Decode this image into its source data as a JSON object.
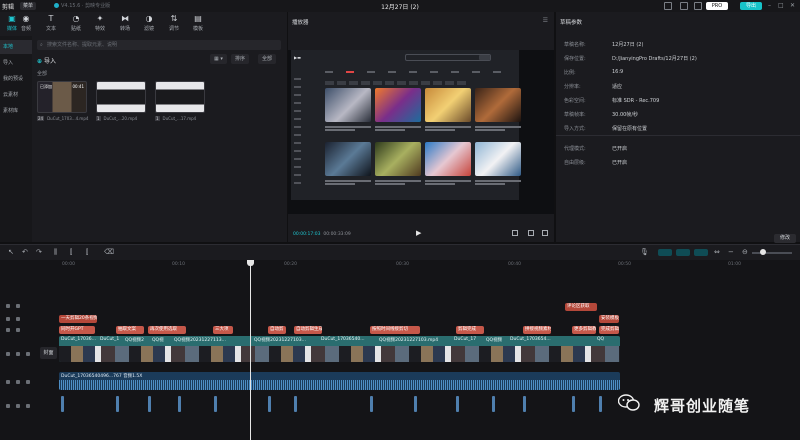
{
  "titlebar": {
    "app_name": "剪辑",
    "menu": "菜单",
    "version": "V4.15.6 · 剪映专业版",
    "doc_title": "12月27日 (2)",
    "pro_label": "PRO",
    "export_label": "导出"
  },
  "toolbar": {
    "tools": [
      {
        "label": "媒体",
        "icon": "media-icon",
        "glyph": "▣",
        "active": true
      },
      {
        "label": "音频",
        "icon": "audio-icon",
        "glyph": "◉"
      },
      {
        "label": "文本",
        "icon": "text-icon",
        "glyph": "T"
      },
      {
        "label": "贴纸",
        "icon": "sticker-icon",
        "glyph": "◔"
      },
      {
        "label": "特效",
        "icon": "effects-icon",
        "glyph": "✦"
      },
      {
        "label": "转场",
        "icon": "transition-icon",
        "glyph": "⧓"
      },
      {
        "label": "滤镜",
        "icon": "filter-icon",
        "glyph": "◑"
      },
      {
        "label": "调节",
        "icon": "adjust-icon",
        "glyph": "⇅"
      },
      {
        "label": "模板",
        "icon": "template-icon",
        "glyph": "▤"
      }
    ]
  },
  "sidebar": {
    "items": [
      {
        "label": "本地",
        "active": true
      },
      {
        "label": "导入"
      },
      {
        "label": "我的预设"
      },
      {
        "label": "云素材"
      },
      {
        "label": "素材库"
      }
    ]
  },
  "media": {
    "search_placeholder": "搜索文件名称、提取元素、说明",
    "import_label": "导入",
    "sort_label": "排序",
    "filter_label": "全部",
    "section": "全部",
    "items": [
      {
        "caption": "已添加",
        "duration": "00:41",
        "tag": "24",
        "name": "DuCut_1703...4.mp4"
      },
      {
        "tag": "1",
        "name": "DuCut_...20.mp4"
      },
      {
        "tag": "1",
        "name": "DuCut_...17.mp4"
      }
    ]
  },
  "player": {
    "title": "播放器",
    "time_current": "00:00:17:03",
    "time_total": "00:00:33:09"
  },
  "props": {
    "title": "草稿参数",
    "rows": [
      {
        "key": "草稿名称:",
        "value": "12月27日 (2)"
      },
      {
        "key": "保存位置:",
        "value": "D:/JianyingPro Drafts/12月27日 (2)"
      },
      {
        "key": "比例:",
        "value": "16:9"
      },
      {
        "key": "分辨率:",
        "value": "适应"
      },
      {
        "key": "色彩空间:",
        "value": "标准 SDR - Rec.709"
      },
      {
        "key": "草稿帧率:",
        "value": "30.00帧/秒"
      },
      {
        "key": "导入方式:",
        "value": "保留在原有位置"
      },
      {
        "key": "代理模式:",
        "value": "已开启"
      },
      {
        "key": "自由层级:",
        "value": "已开启"
      }
    ],
    "edit_label": "修改"
  },
  "timeline": {
    "ruler": [
      "00:00",
      "00:10",
      "00:20",
      "00:30",
      "00:40",
      "00:50",
      "01:00"
    ],
    "cover_label": "封面",
    "text_row1": [
      {
        "text": "一天剪辑20条视频",
        "color": "red"
      },
      {
        "text": "评论区获取",
        "color": "red"
      },
      {
        "text": "安装模板",
        "color": "red"
      }
    ],
    "text_row2": [
      {
        "text": "同时开GPT",
        "color": "salmon"
      },
      {
        "text": "抽取文案",
        "color": "salmon"
      },
      {
        "text": "再次使用选取",
        "color": "salmon"
      },
      {
        "text": "三大项",
        "color": "salmon"
      },
      {
        "text": "自动剪",
        "color": "salmon"
      },
      {
        "text": "自动剪辑生成",
        "color": "salmon"
      },
      {
        "text": "按照时间线接剪切",
        "color": "salmon"
      },
      {
        "text": "剪辑完成",
        "color": "salmon"
      },
      {
        "text": "拼接视频素材",
        "color": "salmon"
      },
      {
        "text": "更多剪辑教程",
        "color": "salmon"
      },
      {
        "text": "完成剪辑",
        "color": "salmon"
      }
    ],
    "video_labels": [
      "DuCut_17036...",
      "DuCut_1",
      "QQ视频2",
      "QQ视",
      "QQ视频20231227113...",
      "QQ视频20231227103...",
      "DuCut_17036540...",
      "QQ视频20231227103.mp4",
      "DuCut_17",
      "QQ视频",
      "DuCut_1703654...",
      "QQ"
    ],
    "audio_label": "DuCut_17036540496...767  音频1.5X",
    "watermark": "辉哥创业随笔"
  }
}
